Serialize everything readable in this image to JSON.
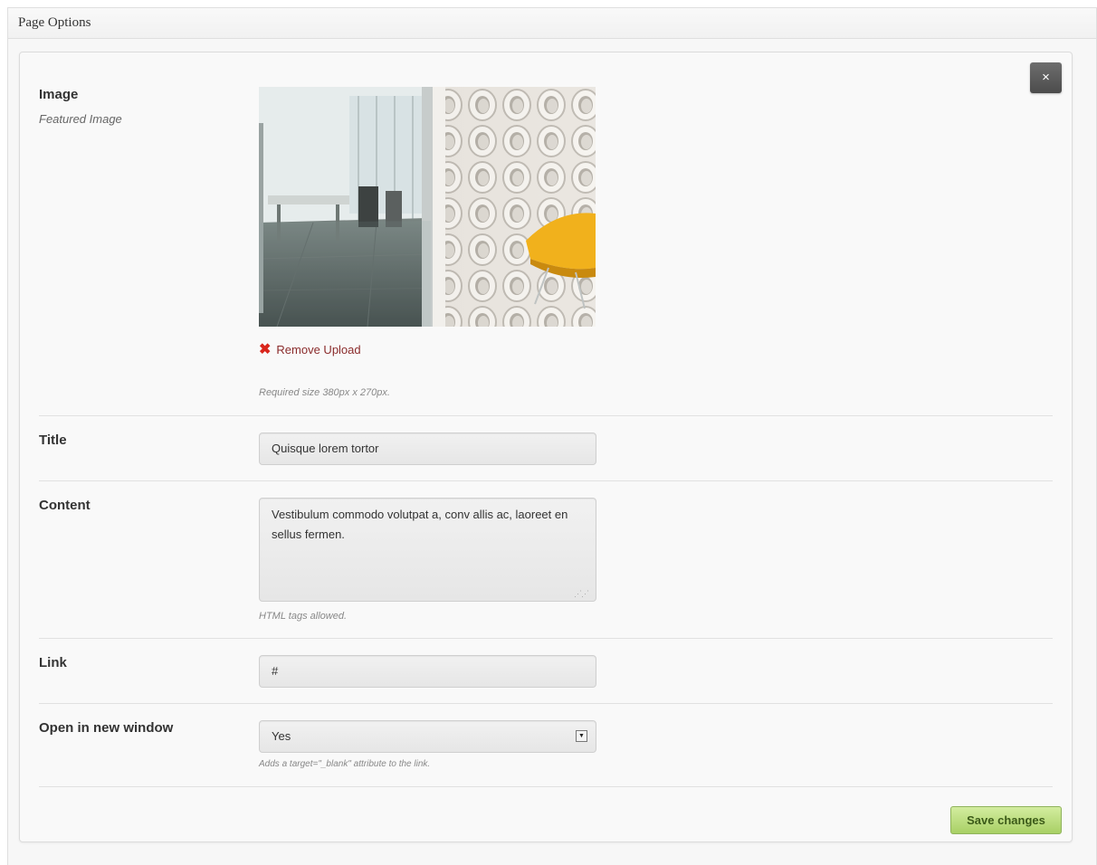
{
  "metabox": {
    "title": "Page Options"
  },
  "close": {
    "label": "×"
  },
  "image_section": {
    "label": "Image",
    "sublabel": "Featured Image",
    "remove_label": "Remove Upload",
    "hint": "Required size 380px x 270px."
  },
  "title_section": {
    "label": "Title",
    "value": "Quisque lorem tortor"
  },
  "content_section": {
    "label": "Content",
    "value": "Vestibulum commodo volutpat a, conv allis ac, laoreet en sellus fermen.",
    "hint": "HTML tags allowed."
  },
  "link_section": {
    "label": "Link",
    "value": "#"
  },
  "window_section": {
    "label": "Open in new window",
    "selected": "Yes",
    "hint": "Adds a target=\"_blank\" attribute to the link."
  },
  "save": {
    "label": "Save changes"
  },
  "icons": {
    "close": "close-icon",
    "remove": "remove-x-icon",
    "select": "dropdown-arrow-icon",
    "resize": "resize-grip-icon"
  },
  "colors": {
    "save_button": "#a8d065",
    "close_button": "#5a5a5a",
    "remove_link": "#8a2b2b",
    "remove_icon": "#d9261c"
  }
}
